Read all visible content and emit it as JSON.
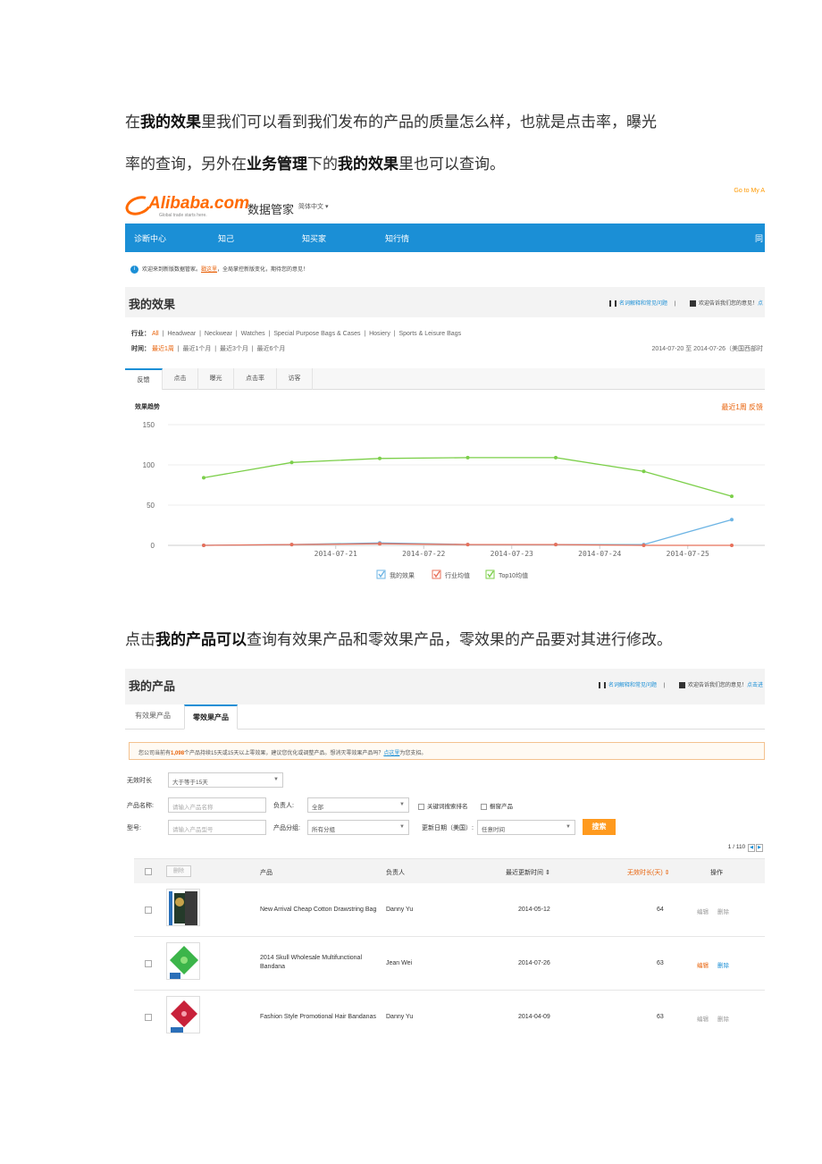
{
  "paragraphs": {
    "p1": {
      "t1": "在",
      "b1": "我的效果",
      "t2": "里我们可以看到我们发布的产品的质量怎么样，也就是点击率，曝光"
    },
    "p2": {
      "t1": "率的查询，另外在",
      "b1": "业务管理",
      "t2": "下的",
      "b2": "我的效果",
      "t3": "里也可以查询。"
    },
    "p3": {
      "t1": "点击",
      "b1": "我的产品可以",
      "t2": "查询有效果产品和零效果产品，零效果的产品要对其进行修改。"
    }
  },
  "shot1": {
    "logo_text": "Alibaba.com",
    "logo_sub": "Global trade starts here.",
    "app_name": "数据管家",
    "lang": "简体中文 ▾",
    "goto": "Go to My A",
    "nav": [
      "诊断中心",
      "知己",
      "知买家",
      "知行情"
    ],
    "nav_right": "同",
    "notice": {
      "pre": "欢迎来到新版数据管家。",
      "link": "戳这里",
      "post": "，全局掌控新版变化，期待您的意见！"
    },
    "section_title": "我的效果",
    "links": {
      "faq": "名词解释和常见问题",
      "sep": "|",
      "feedback_pre": "欢迎告诉我们您的意见！",
      "feedback_link": "点"
    },
    "industry": {
      "label": "行业：",
      "active": "All",
      "items": [
        "Headwear",
        "Neckwear",
        "Watches",
        "Special Purpose Bags & Cases",
        "Hosiery",
        "Sports & Leisure Bags"
      ]
    },
    "time": {
      "label": "时间：",
      "active": "最近1周",
      "items": [
        "最近1个月",
        "最近3个月",
        "最近6个月"
      ]
    },
    "date_range": "2014-07-20 至 2014-07-26（美国西部时",
    "tabs": [
      "反馈",
      "点击",
      "曝光",
      "点击率",
      "访客"
    ],
    "trend_title": "效果趋势",
    "trend_right": "最近1周  反馈"
  },
  "chart_data": {
    "type": "line",
    "x": [
      "2014-07-20",
      "2014-07-21",
      "2014-07-22",
      "2014-07-23",
      "2014-07-24",
      "2014-07-25",
      "2014-07-26"
    ],
    "x_tick_labels": [
      "2014-07-21",
      "2014-07-22",
      "2014-07-23",
      "2014-07-24",
      "2014-07-25"
    ],
    "ylim": [
      0,
      150
    ],
    "y_ticks": [
      0,
      50,
      100,
      150
    ],
    "series": [
      {
        "name": "我的效果",
        "color": "#6cb4e4",
        "values": [
          0,
          1,
          3,
          1,
          1,
          1,
          32
        ]
      },
      {
        "name": "行业均值",
        "color": "#e8705a",
        "values": [
          0,
          1,
          2,
          1,
          1,
          0,
          0
        ]
      },
      {
        "name": "Top10均值",
        "color": "#7ccf4a",
        "values": [
          84,
          103,
          108,
          109,
          109,
          92,
          61
        ]
      }
    ],
    "grid": true,
    "legend": "bottom-center"
  },
  "shot2": {
    "section_title": "我的产品",
    "links": {
      "faq": "名词解释和常见问题",
      "sep": "|",
      "feedback_pre": "欢迎告诉我们您的意见！",
      "feedback_link": "点击进"
    },
    "tabs": [
      "有效果产品",
      "零效果产品"
    ],
    "warn": {
      "pre": "您公司当前有",
      "count": "1,098",
      "mid": "个产品持续15天或15天以上零效果，建议您优化或调整产品。想消灭零效果产品吗？",
      "link": "点这里",
      "post": "为您支招。"
    },
    "filters": {
      "no_effect_label": "无效时长",
      "no_effect_value": "大于等于15天",
      "product_name_label": "产品名称:",
      "product_name_ph": "请输入产品名称",
      "owner_label": "负责人:",
      "owner_value": "全部",
      "model_label": "型号:",
      "model_ph": "请输入产品型号",
      "group_label": "产品分组:",
      "group_value": "所有分组",
      "chk1": "关键词搜索排名",
      "chk2": "橱窗产品",
      "update_label": "更新日期（美国）:",
      "update_value": "任意时间",
      "search": "搜索"
    },
    "pager": "1 / 110",
    "table": {
      "delete": "删除",
      "headers": [
        "产品",
        "负责人",
        "最近更新时间 ⇕",
        "无效时长(天) ⇕",
        "操作"
      ],
      "rows": [
        {
          "product": "New Arrival Cheap Cotton Drawstring Bag",
          "owner": "Danny Yu",
          "date": "2014-05-12",
          "days": "64",
          "edit": "编辑",
          "del": "删除"
        },
        {
          "product": "2014 Skull Wholesale Multifunctional Bandana",
          "owner": "Jean Wei",
          "date": "2014-07-26",
          "days": "63",
          "edit": "编辑",
          "del": "删除"
        },
        {
          "product": "Fashion Style Promotional Hair Bandanas",
          "owner": "Danny Yu",
          "date": "2014-04-09",
          "days": "63",
          "edit": "编辑",
          "del": "删除"
        }
      ]
    }
  }
}
